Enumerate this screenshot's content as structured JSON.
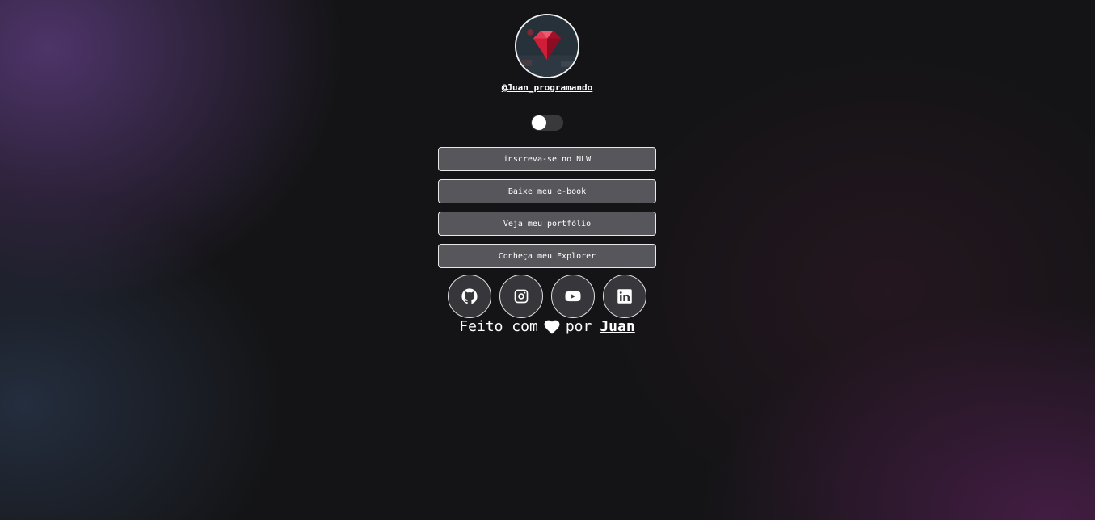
{
  "profile": {
    "avatar_icon": "ruby-gem-avatar",
    "handle": "@Juan_programando"
  },
  "theme_switch": {
    "state": "off"
  },
  "links": [
    {
      "label": "inscreva-se no NLW"
    },
    {
      "label": "Baixe meu e-book"
    },
    {
      "label": "Veja meu portfólio"
    },
    {
      "label": "Conheça meu Explorer"
    }
  ],
  "socials": [
    {
      "icon": "github-icon"
    },
    {
      "icon": "instagram-icon"
    },
    {
      "icon": "youtube-icon"
    },
    {
      "icon": "linkedin-icon"
    }
  ],
  "footer": {
    "prefix": "Feito com",
    "heart_icon": "heart-icon",
    "middle": "por",
    "author": "Juan"
  },
  "colors": {
    "background": "#141416",
    "button_bg": "#69696f",
    "border": "#e8e8ea",
    "text": "#ffffff",
    "gem_red": "#c0162e"
  }
}
